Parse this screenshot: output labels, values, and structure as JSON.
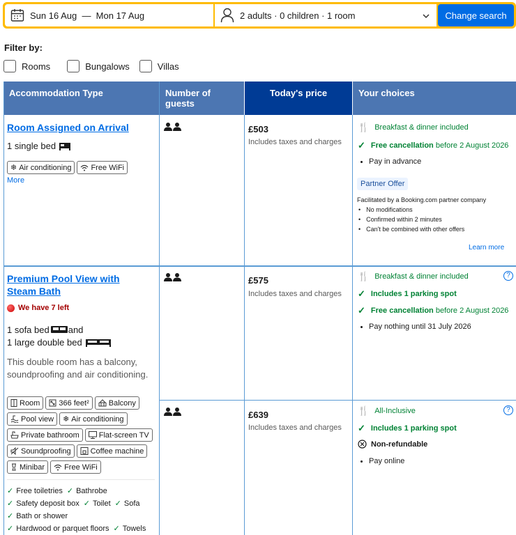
{
  "search": {
    "dates": "Sun 16 Aug  —  Mon 17 Aug",
    "guests": "2 adults · 0 children · 1 room",
    "button": "Change search"
  },
  "filters": {
    "title": "Filter by:",
    "options": [
      "Rooms",
      "Bungalows",
      "Villas"
    ]
  },
  "table": {
    "headers": [
      "Accommodation Type",
      "Number of guests",
      "Today's price",
      "Your choices"
    ]
  },
  "rooms": [
    {
      "name": "Room Assigned on Arrival",
      "bed": "1 single bed",
      "facilities": [
        "Air conditioning",
        "Free WiFi"
      ],
      "more": "More",
      "options": [
        {
          "price": "£503",
          "price_note": "Includes taxes and charges",
          "meal": "Breakfast & dinner included",
          "cancel_bold": "Free cancellation",
          "cancel_rest": " before 2 August 2026",
          "pay": "Pay in advance",
          "partner_badge": "Partner Offer",
          "partner_text": "Facilitated by a Booking.com partner company",
          "partner_points": [
            "No modifications",
            "Confirmed within 2 minutes",
            "Can't be combined with other offers"
          ],
          "learn_more": "Learn more"
        }
      ]
    },
    {
      "name_line1": "Premium Pool View with",
      "name_line2": "Steam Bath",
      "scarcity": "We have 7 left",
      "bed_line1a": "1 sofa bed",
      "bed_line1b": "and",
      "bed_line2": "1 large double bed",
      "description_line1": "This double room has a balcony,",
      "description_line2": "soundproofing and air conditioning.",
      "facilities": [
        "Room",
        "366 feet²",
        "Balcony",
        "Pool view",
        "Air conditioning",
        "Private bathroom",
        "Flat-screen TV",
        "Soundproofing",
        "Coffee machine",
        "Minibar",
        "Free WiFi"
      ],
      "amenities": [
        [
          "Free toiletries",
          "Bathrobe"
        ],
        [
          "Safety deposit box",
          "Toilet",
          "Sofa"
        ],
        [
          "Bath or shower"
        ],
        [
          "Hardwood or parquet floors",
          "Towels"
        ]
      ],
      "options": [
        {
          "price": "£575",
          "price_note": "Includes taxes and charges",
          "meal": "Breakfast & dinner included",
          "parking": "Includes 1 parking spot",
          "cancel_bold": "Free cancellation",
          "cancel_rest": " before 2 August 2026",
          "pay": "Pay nothing until 31 July 2026"
        },
        {
          "price": "£639",
          "price_note": "Includes taxes and charges",
          "meal": "All-Inclusive",
          "parking": "Includes 1 parking spot",
          "refund": "Non-refundable",
          "pay": "Pay online"
        }
      ]
    }
  ],
  "colors": {
    "header": "#4c76b2",
    "header_price": "#003b95",
    "accent": "#006ce4",
    "green": "#008234",
    "yellow": "#febb02"
  }
}
